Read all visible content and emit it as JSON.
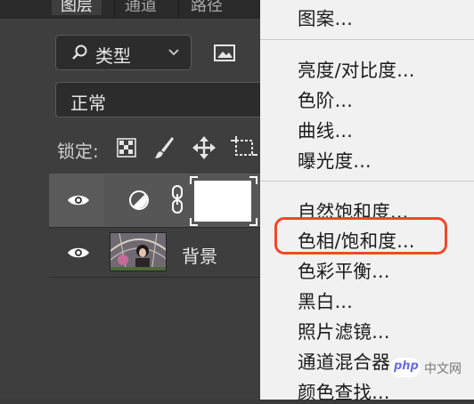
{
  "panel": {
    "tabs": [
      {
        "label": "图层",
        "active": true
      },
      {
        "label": "通道",
        "active": false
      },
      {
        "label": "路径",
        "active": false
      }
    ],
    "filter_kind_label": "类型",
    "blend_mode_label": "正常",
    "lock_label": "锁定:",
    "layers": [
      {
        "type": "adjustment",
        "visible": true,
        "selected": true
      },
      {
        "type": "image",
        "name": "背景",
        "visible": true,
        "selected": false
      }
    ]
  },
  "menu": {
    "items": [
      "图案...",
      "亮度/对比度...",
      "色阶...",
      "曲线...",
      "曝光度...",
      "自然饱和度...",
      "色相/饱和度...",
      "色彩平衡...",
      "黑白...",
      "照片滤镜...",
      "通道混合器...",
      "颜色查找..."
    ],
    "highlighted_item": "色相/饱和度...",
    "highlight_color": "#f0482a"
  },
  "watermark": {
    "logo_text": "php",
    "text": "中文网"
  },
  "icons": [
    "search-icon",
    "chevron-down-icon",
    "image-filter-icon",
    "lock-transparent-pixels-icon",
    "lock-image-pixels-icon",
    "lock-position-icon",
    "lock-artboard-icon",
    "eye-icon",
    "adjustment-circle-icon",
    "chain-link-icon"
  ]
}
